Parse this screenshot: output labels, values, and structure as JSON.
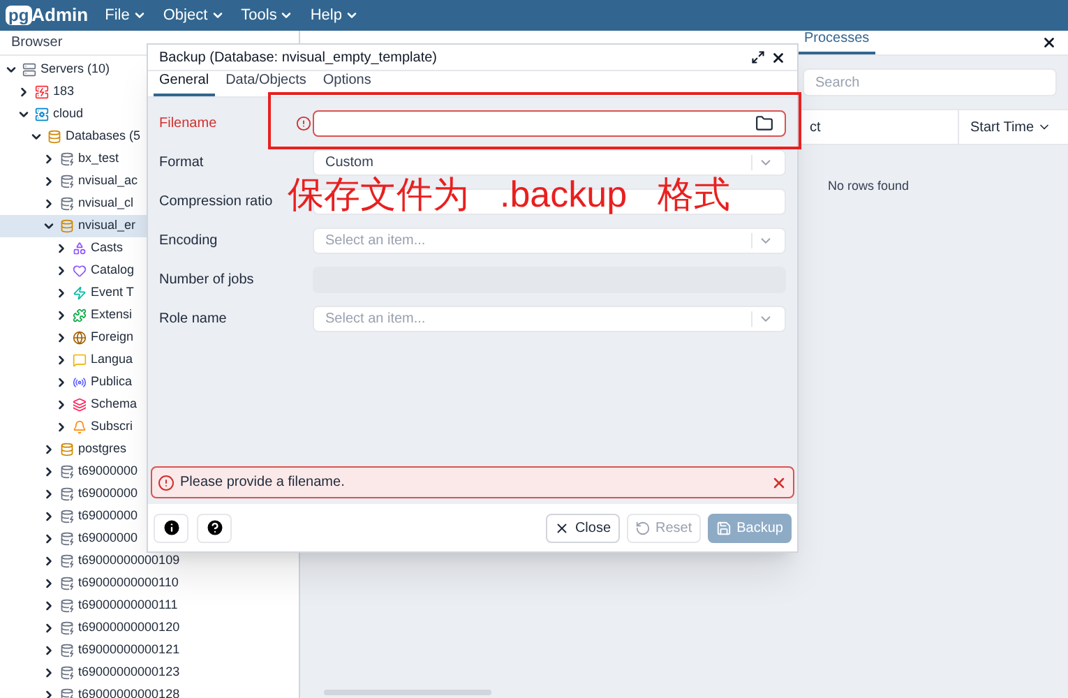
{
  "app": {
    "logo_prefix": "pg",
    "logo_name": "Admin",
    "menus": [
      "File",
      "Object",
      "Tools",
      "Help"
    ]
  },
  "browser": {
    "title": "Browser",
    "tree": [
      {
        "label": "Servers (10)",
        "kind": "servers",
        "expanded": true,
        "selected": false,
        "children": [
          {
            "label": "183",
            "kind": "server-off",
            "expanded": false,
            "selected": false
          },
          {
            "label": "cloud",
            "kind": "server",
            "expanded": true,
            "selected": false,
            "children": [
              {
                "label": "Databases (5",
                "kind": "databases",
                "expanded": true,
                "selected": false,
                "children": [
                  {
                    "label": "bx_test",
                    "kind": "database-off",
                    "expanded": false,
                    "selected": false
                  },
                  {
                    "label": "nvisual_ac",
                    "kind": "database-off",
                    "expanded": false,
                    "selected": false
                  },
                  {
                    "label": "nvisual_cl",
                    "kind": "database-off",
                    "expanded": false,
                    "selected": false
                  },
                  {
                    "label": "nvisual_er",
                    "kind": "database",
                    "expanded": true,
                    "selected": true,
                    "children": [
                      {
                        "label": "Casts",
                        "kind": "casts",
                        "expanded": false,
                        "selected": false
                      },
                      {
                        "label": "Catalog",
                        "kind": "catalogs",
                        "expanded": false,
                        "selected": false
                      },
                      {
                        "label": "Event T",
                        "kind": "event-triggers",
                        "expanded": false,
                        "selected": false
                      },
                      {
                        "label": "Extensi",
                        "kind": "extensions",
                        "expanded": false,
                        "selected": false
                      },
                      {
                        "label": "Foreign",
                        "kind": "foreign-data",
                        "expanded": false,
                        "selected": false
                      },
                      {
                        "label": "Langua",
                        "kind": "languages",
                        "expanded": false,
                        "selected": false
                      },
                      {
                        "label": "Publica",
                        "kind": "publications",
                        "expanded": false,
                        "selected": false
                      },
                      {
                        "label": "Schema",
                        "kind": "schemas",
                        "expanded": false,
                        "selected": false
                      },
                      {
                        "label": "Subscri",
                        "kind": "subscriptions",
                        "expanded": false,
                        "selected": false
                      }
                    ]
                  },
                  {
                    "label": "postgres",
                    "kind": "database",
                    "expanded": false,
                    "selected": false
                  },
                  {
                    "label": "t69000000",
                    "kind": "database-off",
                    "expanded": false,
                    "selected": false
                  },
                  {
                    "label": "t69000000",
                    "kind": "database-off",
                    "expanded": false,
                    "selected": false
                  },
                  {
                    "label": "t69000000",
                    "kind": "database-off",
                    "expanded": false,
                    "selected": false
                  },
                  {
                    "label": "t69000000",
                    "kind": "database-off",
                    "expanded": false,
                    "selected": false
                  },
                  {
                    "label": "t69000000000109",
                    "kind": "database-off",
                    "expanded": false,
                    "selected": false
                  },
                  {
                    "label": "t69000000000110",
                    "kind": "database-off",
                    "expanded": false,
                    "selected": false
                  },
                  {
                    "label": "t69000000000111",
                    "kind": "database-off",
                    "expanded": false,
                    "selected": false
                  },
                  {
                    "label": "t69000000000120",
                    "kind": "database-off",
                    "expanded": false,
                    "selected": false
                  },
                  {
                    "label": "t69000000000121",
                    "kind": "database-off",
                    "expanded": false,
                    "selected": false
                  },
                  {
                    "label": "t69000000000123",
                    "kind": "database-off",
                    "expanded": false,
                    "selected": false
                  },
                  {
                    "label": "t69000000000128",
                    "kind": "database-off",
                    "expanded": false,
                    "selected": false
                  }
                ]
              }
            ]
          }
        ]
      }
    ]
  },
  "main": {
    "tabs": [
      {
        "label": "Processes",
        "selected": true
      }
    ],
    "search": {
      "placeholder": "Search"
    },
    "columns": [
      "ct",
      "Start Time"
    ],
    "empty_text": "No rows found"
  },
  "dialog": {
    "title": "Backup (Database: nvisual_empty_template)",
    "tabs": [
      {
        "label": "General",
        "selected": true
      },
      {
        "label": "Data/Objects",
        "selected": false
      },
      {
        "label": "Options",
        "selected": false
      }
    ],
    "fields": [
      {
        "label": "Filename",
        "kind": "file",
        "invalid": true,
        "disabled": false
      },
      {
        "label": "Format",
        "kind": "select",
        "value": "Custom",
        "invalid": false,
        "disabled": false
      },
      {
        "label": "Compression ratio",
        "kind": "input",
        "invalid": false,
        "disabled": false
      },
      {
        "label": "Encoding",
        "kind": "select",
        "placeholder": "Select an item...",
        "invalid": false,
        "disabled": false
      },
      {
        "label": "Number of jobs",
        "kind": "input",
        "invalid": false,
        "disabled": true
      },
      {
        "label": "Role name",
        "kind": "select",
        "placeholder": "Select an item...",
        "invalid": false,
        "disabled": false
      }
    ],
    "error": "Please provide a filename.",
    "left_buttons": [
      {
        "kind": "info"
      },
      {
        "kind": "help"
      }
    ],
    "buttons": [
      {
        "label": "Close",
        "kind": "close",
        "disabled": false,
        "primary": false
      },
      {
        "label": "Reset",
        "kind": "reset",
        "disabled": true,
        "primary": false
      },
      {
        "label": "Backup",
        "kind": "save",
        "disabled": true,
        "primary": true
      }
    ]
  },
  "annotation": {
    "parts": [
      "保存文件为",
      ".backup",
      "格式"
    ]
  }
}
